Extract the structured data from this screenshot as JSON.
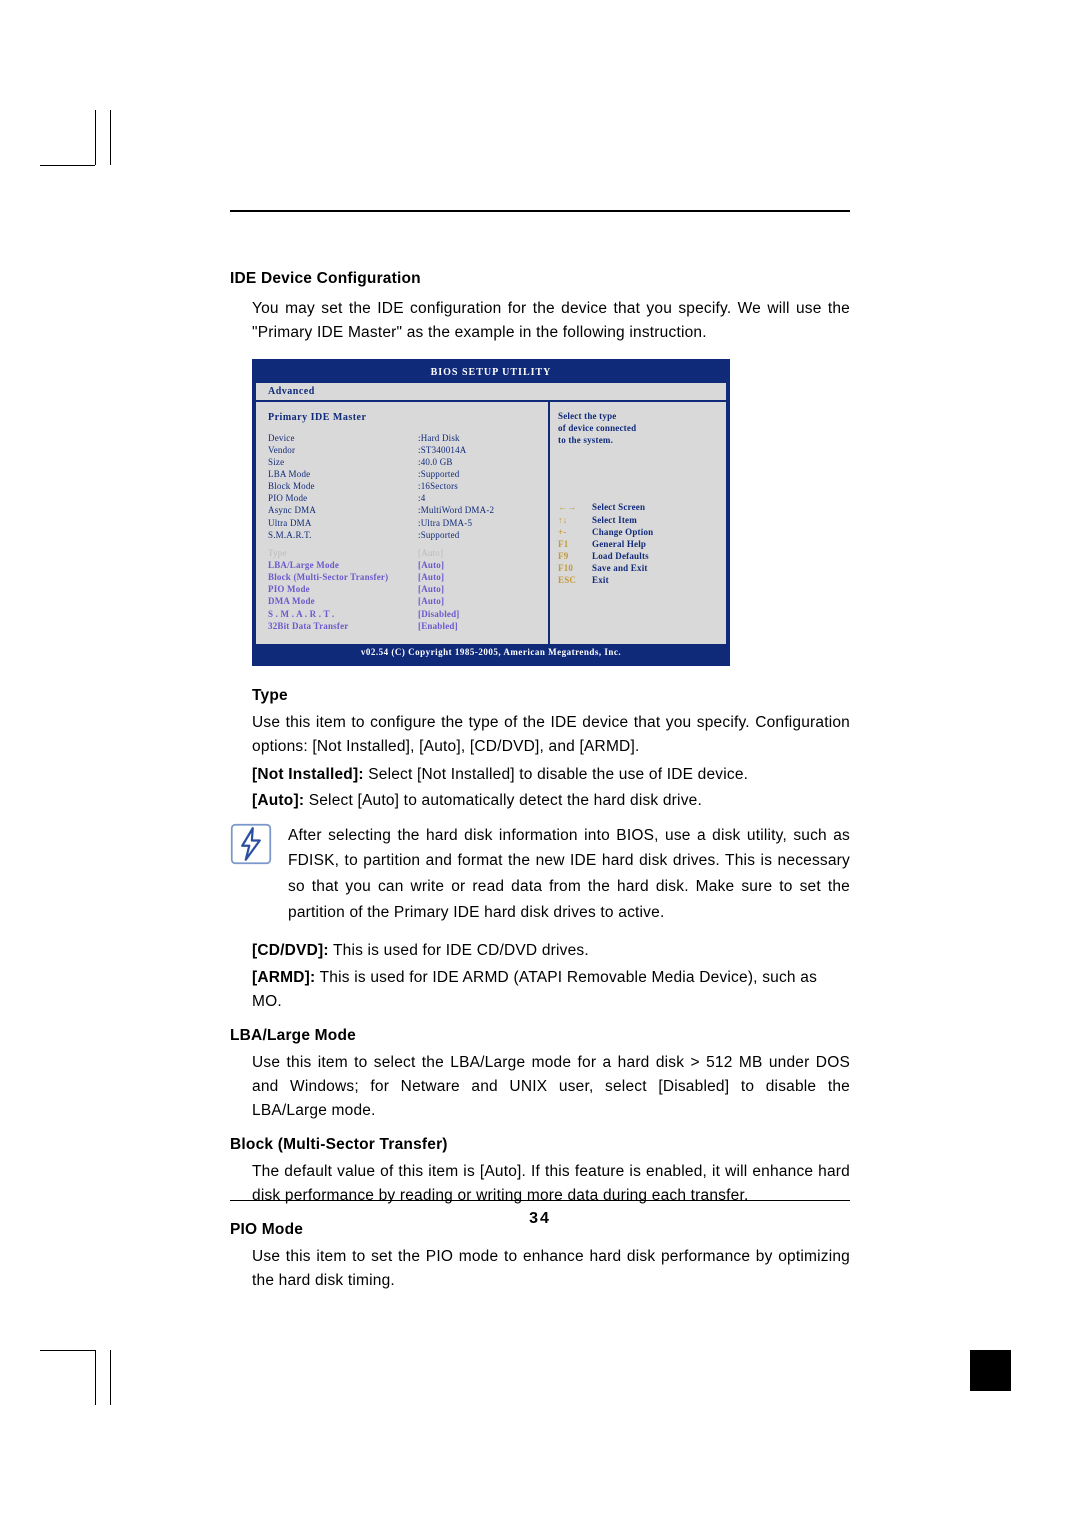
{
  "page_number": "34",
  "section": {
    "title": "IDE Device Configuration",
    "intro": "You may set the IDE configuration for the device that you specify. We will use the \"Primary IDE Master\" as the example in the following instruction."
  },
  "bios": {
    "title": "BIOS SETUP UTILITY",
    "tab": "Advanced",
    "panel_header": "Primary IDE Master",
    "info": [
      {
        "k": "Device",
        "v": ":Hard Disk"
      },
      {
        "k": "Vendor",
        "v": ":ST340014A"
      },
      {
        "k": "Size",
        "v": ":40.0 GB"
      },
      {
        "k": "LBA Mode",
        "v": ":Supported"
      },
      {
        "k": "Block Mode",
        "v": ":16Sectors"
      },
      {
        "k": "PIO Mode",
        "v": ":4"
      },
      {
        "k": "Async DMA",
        "v": ":MultiWord DMA-2"
      },
      {
        "k": "Ultra DMA",
        "v": ":Ultra DMA-5"
      },
      {
        "k": "S.M.A.R.T.",
        "v": ":Supported"
      }
    ],
    "selected": {
      "k": "Type",
      "v": "[Auto]"
    },
    "options": [
      {
        "k": "LBA/Large Mode",
        "v": "[Auto]"
      },
      {
        "k": "Block (Multi-Sector Transfer)",
        "v": "[Auto]"
      },
      {
        "k": "PIO Mode",
        "v": "[Auto]"
      },
      {
        "k": "DMA Mode",
        "v": "[Auto]"
      },
      {
        "k": "S . M . A . R . T .",
        "v": "[Disabled]"
      },
      {
        "k": "32Bit Data Transfer",
        "v": "[Enabled]"
      }
    ],
    "help": {
      "lines": [
        "Select the type",
        "of device connected",
        "to the system."
      ]
    },
    "keys": [
      {
        "key": "←→",
        "act": "Select Screen"
      },
      {
        "key": "↑↓",
        "act": "Select Item"
      },
      {
        "key": "+-",
        "act": "Change Option"
      },
      {
        "key": "F1",
        "act": "General Help"
      },
      {
        "key": "F9",
        "act": "Load Defaults"
      },
      {
        "key": "F10",
        "act": "Save and Exit"
      },
      {
        "key": "ESC",
        "act": "Exit"
      }
    ],
    "footer": "v02.54 (C) Copyright 1985-2005, American Megatrends, Inc."
  },
  "type_section": {
    "heading": "Type",
    "p1": "Use this item to configure the type of the IDE device that you specify. Configuration options: [Not Installed], [Auto], [CD/DVD], and [ARMD].",
    "not_installed_label": "[Not Installed]:",
    "not_installed_text": " Select [Not Installed] to disable the use of IDE device.",
    "auto_label": "[Auto]:",
    "auto_text": " Select [Auto] to automatically detect the hard disk drive.",
    "note": "After selecting the hard disk information into BIOS, use a disk utility, such as FDISK, to partition and format the new IDE hard disk drives. This is necessary so that you can write or read data from the hard disk. Make sure to set the partition of the Primary IDE hard disk drives to active.",
    "cddvd_label": "[CD/DVD]:",
    "cddvd_text": "This is used for IDE CD/DVD drives.",
    "armd_label": "[ARMD]:",
    "armd_text": "This is used for IDE ARMD (ATAPI Removable Media Device), such as MO.",
    "armd_cont": "such as MO."
  },
  "lba": {
    "heading": "LBA/Large Mode",
    "text": "Use this item to select the LBA/Large mode for a hard disk > 512 MB under DOS and Windows; for Netware and UNIX user, select [Disabled] to disable the LBA/Large mode."
  },
  "block": {
    "heading": "Block (Multi-Sector Transfer)",
    "text": "The default value of this item is [Auto]. If this feature is enabled, it will enhance hard disk performance by reading or writing more data during each transfer."
  },
  "pio": {
    "heading": "PIO Mode",
    "text": "Use this item to set the PIO mode to enhance hard disk performance by optimizing the hard disk timing."
  }
}
